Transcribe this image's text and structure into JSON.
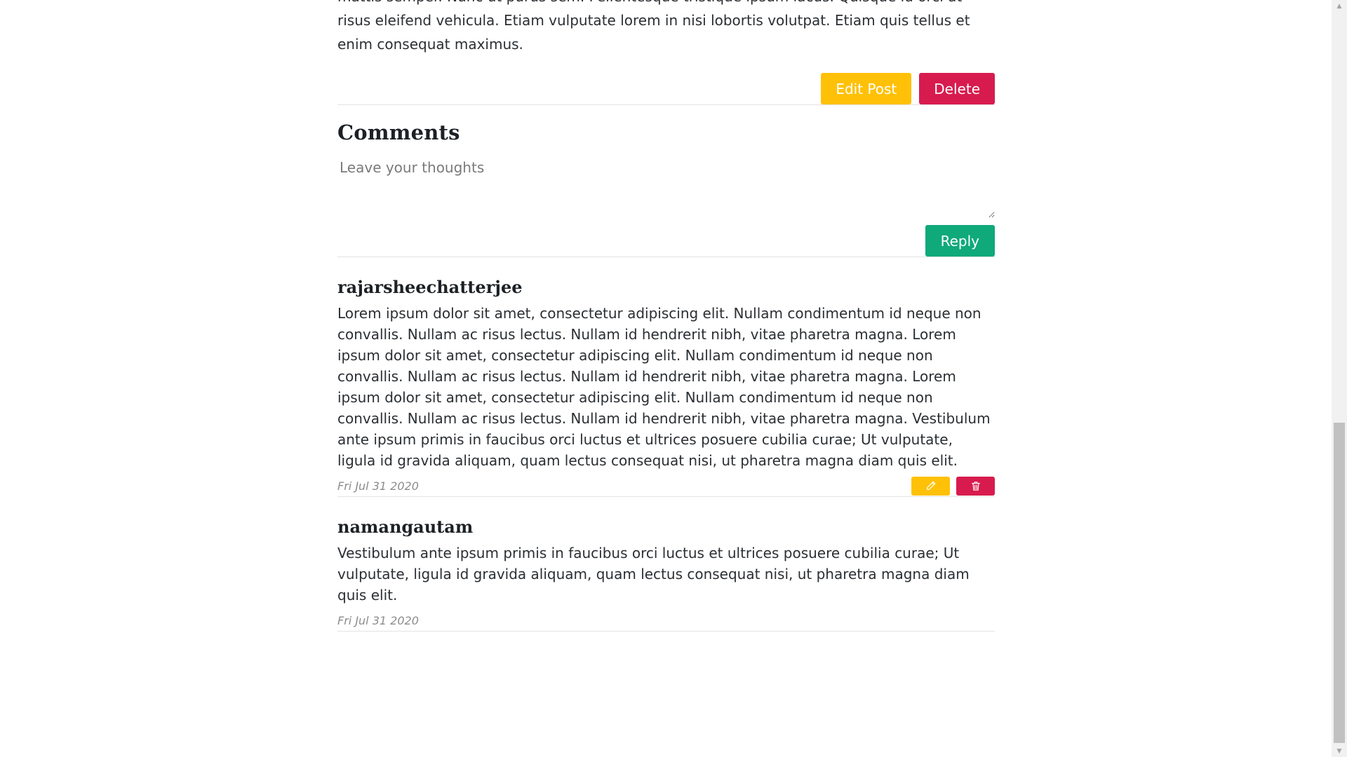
{
  "post": {
    "body_tail": "mattis semper. Nunc ut purus sem. Pellentesque tristique ipsum lacus. Quisque id orci at risus eleifend vehicula. Etiam vulputate lorem in nisi lobortis volutpat. Etiam quis tellus et enim consequat maximus.",
    "edit_label": "Edit Post",
    "delete_label": "Delete"
  },
  "comments_section": {
    "title": "Comments",
    "input_placeholder": "Leave your thoughts",
    "input_value": "",
    "reply_label": "Reply"
  },
  "comments": [
    {
      "author": "rajarsheechatterjee",
      "text": "Lorem ipsum dolor sit amet, consectetur adipiscing elit. Nullam condimentum id neque non convallis. Nullam ac risus lectus. Nullam id hendrerit nibh, vitae pharetra magna. Lorem ipsum dolor sit amet, consectetur adipiscing elit. Nullam condimentum id neque non convallis. Nullam ac risus lectus. Nullam id hendrerit nibh, vitae pharetra magna. Lorem ipsum dolor sit amet, consectetur adipiscing elit. Nullam condimentum id neque non convallis. Nullam ac risus lectus. Nullam id hendrerit nibh, vitae pharetra magna. Vestibulum ante ipsum primis in faucibus orci luctus et ultrices posuere cubilia curae; Ut vulputate, ligula id gravida aliquam, quam lectus consequat nisi, ut pharetra magna diam quis elit.",
      "date": "Fri Jul 31 2020",
      "actions": [
        "pencil-icon",
        "trash-icon"
      ]
    },
    {
      "author": "namangautam",
      "text": "Vestibulum ante ipsum primis in faucibus orci luctus et ultrices posuere cubilia curae; Ut vulputate, ligula id gravida aliquam, quam lectus consequat nisi, ut pharetra magna diam quis elit.",
      "date": "Fri Jul 31 2020"
    }
  ],
  "colors": {
    "warning": "#ffc107",
    "danger": "#d81b4e",
    "success": "#0fa97a"
  }
}
